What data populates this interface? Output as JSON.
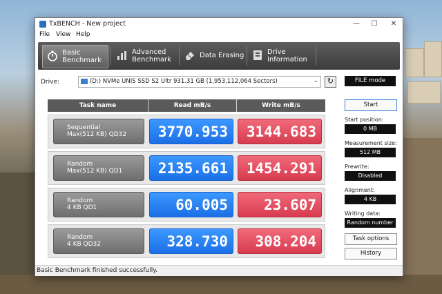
{
  "window": {
    "title": "TxBENCH - New project",
    "controls": {
      "minimize": "—",
      "maximize": "☐",
      "close": "✕"
    }
  },
  "menu": {
    "items": [
      "File",
      "View",
      "Help"
    ]
  },
  "toolbar": {
    "tabs": [
      {
        "line1": "Basic",
        "line2": "Benchmark",
        "icon": "stopwatch-icon",
        "active": true
      },
      {
        "line1": "Advanced",
        "line2": "Benchmark",
        "icon": "bar-chart-icon",
        "active": false
      },
      {
        "line1": "Data Erasing",
        "line2": "",
        "icon": "eraser-icon",
        "active": false
      },
      {
        "line1": "Drive",
        "line2": "Information",
        "icon": "drive-info-icon",
        "active": false
      }
    ]
  },
  "drive": {
    "label": "Drive:",
    "selected": "(D:) NVMe UNIS SSD S2 Ultr  931.31 GB (1,953,112,064 Sectors)",
    "refresh_glyph": "↻",
    "file_mode_label": "FILE mode"
  },
  "bench": {
    "headers": {
      "task": "Task name",
      "read": "Read mB/s",
      "write": "Write mB/s"
    },
    "rows": [
      {
        "line1": "Sequential",
        "line2": "Max(512 KB) QD32",
        "read": "3770.953",
        "write": "3144.683"
      },
      {
        "line1": "Random",
        "line2": "Max(512 KB) QD1",
        "read": "2135.661",
        "write": "1454.291"
      },
      {
        "line1": "Random",
        "line2": "4 KB QD1",
        "read": "60.005",
        "write": "23.607"
      },
      {
        "line1": "Random",
        "line2": "4 KB QD32",
        "read": "328.730",
        "write": "308.204"
      }
    ]
  },
  "panel": {
    "start_label": "Start",
    "start_position_label": "Start position:",
    "start_position_value": "0 MB",
    "measurement_size_label": "Measurement size:",
    "measurement_size_value": "512 MB",
    "prewrite_label": "Prewrite:",
    "prewrite_value": "Disabled",
    "alignment_label": "Alignment:",
    "alignment_value": "4 KB",
    "writing_data_label": "Writing data:",
    "writing_data_value": "Random number",
    "task_options_label": "Task options",
    "history_label": "History"
  },
  "status": {
    "text": "Basic Benchmark finished successfully."
  },
  "colors": {
    "read": "#2a7fff",
    "write": "#e5485c",
    "toolbar": "#4a4a4a"
  }
}
